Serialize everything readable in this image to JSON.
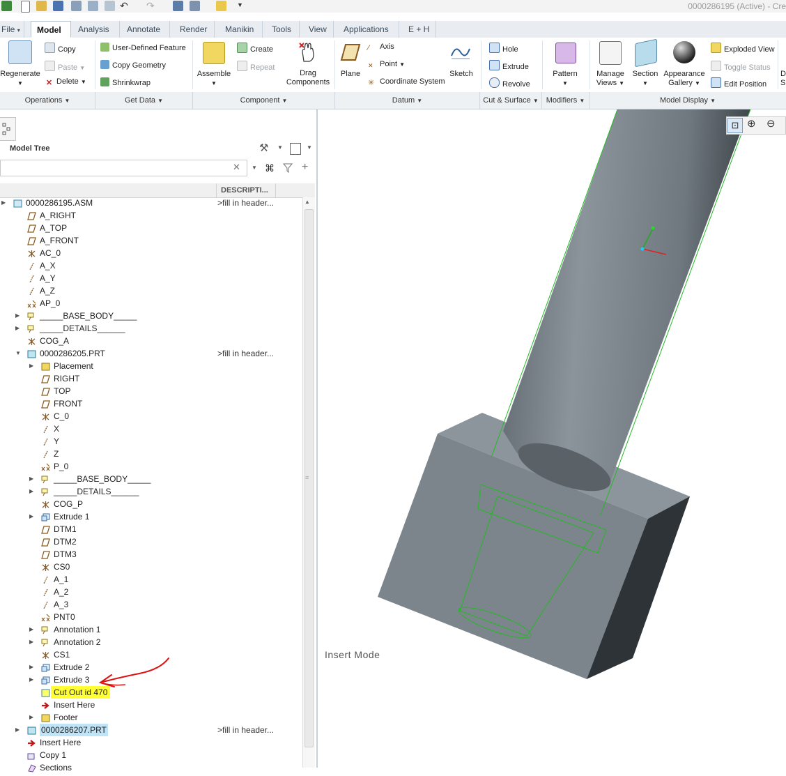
{
  "window": {
    "title": "0000286195 (Active) - Cre"
  },
  "tabs": [
    "File",
    "Model",
    "Analysis",
    "Annotate",
    "Render",
    "Manikin",
    "Tools",
    "View",
    "Applications",
    "E + H"
  ],
  "ribbon": {
    "regenerate": "Regenerate",
    "copy": "Copy",
    "paste": "Paste",
    "delete": "Delete",
    "user_defined_feature": "User-Defined Feature",
    "copy_geometry": "Copy Geometry",
    "shrinkwrap": "Shrinkwrap",
    "assemble": "Assemble",
    "create": "Create",
    "repeat": "Repeat",
    "drag_components_1": "Drag",
    "drag_components_2": "Components",
    "plane": "Plane",
    "axis": "Axis",
    "point": "Point",
    "coordinate_system": "Coordinate System",
    "sketch": "Sketch",
    "hole": "Hole",
    "extrude": "Extrude",
    "revolve": "Revolve",
    "pattern": "Pattern",
    "manage_views_1": "Manage",
    "manage_views_2": "Views",
    "section": "Section",
    "appearance_gallery_1": "Appearance",
    "appearance_gallery_2": "Gallery",
    "exploded_view": "Exploded View",
    "toggle_status": "Toggle Status",
    "edit_position": "Edit Position",
    "cutoff_1": "D",
    "cutoff_2": "S"
  },
  "groups": [
    "Operations",
    "Get Data",
    "Component",
    "Datum",
    "Cut & Surface",
    "Modifiers",
    "Model Display"
  ],
  "model_tree": {
    "title": "Model Tree",
    "column_header": "DESCRIPTI...",
    "desc_value": ">fill in header...",
    "items": [
      {
        "label": "0000286195.ASM",
        "desc": ">fill in header..."
      },
      {
        "label": "A_RIGHT"
      },
      {
        "label": "A_TOP"
      },
      {
        "label": "A_FRONT"
      },
      {
        "label": "AC_0"
      },
      {
        "label": "A_X"
      },
      {
        "label": "A_Y"
      },
      {
        "label": "A_Z"
      },
      {
        "label": "AP_0"
      },
      {
        "label": "_____BASE_BODY_____"
      },
      {
        "label": "_____DETAILS______"
      },
      {
        "label": "COG_A"
      },
      {
        "label": "0000286205.PRT",
        "desc": ">fill in header..."
      },
      {
        "label": "Placement"
      },
      {
        "label": "RIGHT"
      },
      {
        "label": "TOP"
      },
      {
        "label": "FRONT"
      },
      {
        "label": "C_0"
      },
      {
        "label": "X"
      },
      {
        "label": "Y"
      },
      {
        "label": "Z"
      },
      {
        "label": "P_0"
      },
      {
        "label": "_____BASE_BODY_____"
      },
      {
        "label": "_____DETAILS______"
      },
      {
        "label": "COG_P"
      },
      {
        "label": "Extrude 1"
      },
      {
        "label": "DTM1"
      },
      {
        "label": "DTM2"
      },
      {
        "label": "DTM3"
      },
      {
        "label": "CS0"
      },
      {
        "label": "A_1"
      },
      {
        "label": "A_2"
      },
      {
        "label": "A_3"
      },
      {
        "label": "PNT0"
      },
      {
        "label": "Annotation 1"
      },
      {
        "label": "Annotation 2"
      },
      {
        "label": "CS1"
      },
      {
        "label": "Extrude 2"
      },
      {
        "label": "Extrude 3"
      },
      {
        "label": "Cut Out id 470"
      },
      {
        "label": "Insert Here"
      },
      {
        "label": "Footer"
      },
      {
        "label": "0000286207.PRT",
        "desc": ">fill in header..."
      },
      {
        "label": "Insert Here"
      },
      {
        "label": "Copy 1"
      },
      {
        "label": "Sections"
      }
    ]
  },
  "viewport": {
    "mode_text": "Insert Mode"
  },
  "colors": {
    "highlight_yellow": "#ffff33",
    "selected_blue": "#bfe3f7",
    "annotation_arrow": "#e01010",
    "model_gray": "#7c858c",
    "edge_green": "#22bb22"
  }
}
